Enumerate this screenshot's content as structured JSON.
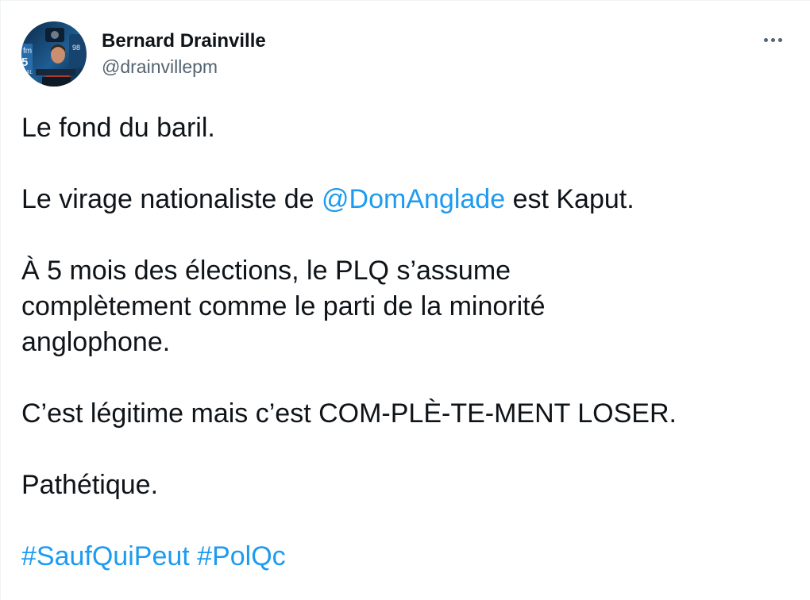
{
  "author": {
    "display_name": "Bernard Drainville",
    "handle": "@drainvillepm",
    "avatar_icon": "profile-photo-radio-studio"
  },
  "more_icon": "more-horizontal-icon",
  "tweet": {
    "line1": "Le fond du baril.",
    "line2_before": "Le virage nationaliste de ",
    "line2_mention": "@DomAnglade",
    "line2_after": " est Kaput.",
    "line3a": "À 5 mois des élections, le PLQ s’assume",
    "line3b": "complètement comme le parti de la minorité",
    "line3c": "anglophone.",
    "line4": "C’est légitime mais c’est COM-PLÈ-TE-MENT LOSER.",
    "line5": "Pathétique.",
    "hashtags": [
      "#SaufQuiPeut",
      "#PolQc"
    ]
  },
  "colors": {
    "link": "#1d9bf0",
    "text": "#0f1419",
    "secondary": "#536471"
  }
}
